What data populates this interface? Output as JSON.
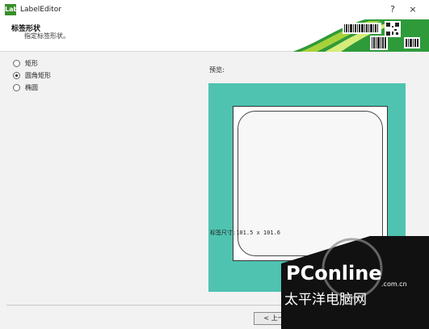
{
  "window": {
    "title": "LabelEditor",
    "help_label": "?",
    "close_label": "×",
    "icon_text": "Lab"
  },
  "header": {
    "title": "标签形状",
    "subtitle": "指定标签形状。"
  },
  "shape_options": [
    {
      "label": "矩形",
      "checked": false
    },
    {
      "label": "圆角矩形",
      "checked": true
    },
    {
      "label": "椭圆",
      "checked": false
    }
  ],
  "preview": {
    "label": "预览:",
    "size_text": "标签尺寸:101.5 x 101.6"
  },
  "footer": {
    "prev_label": "< 上一步"
  },
  "watermark": {
    "brand": "PConline",
    "domain": ".com.cn",
    "cn_text": "太平洋电脑网"
  },
  "colors": {
    "preview_bg": "#4fc3b0",
    "banner_green": "#2f9a3a",
    "banner_lime": "#a6d23c"
  }
}
